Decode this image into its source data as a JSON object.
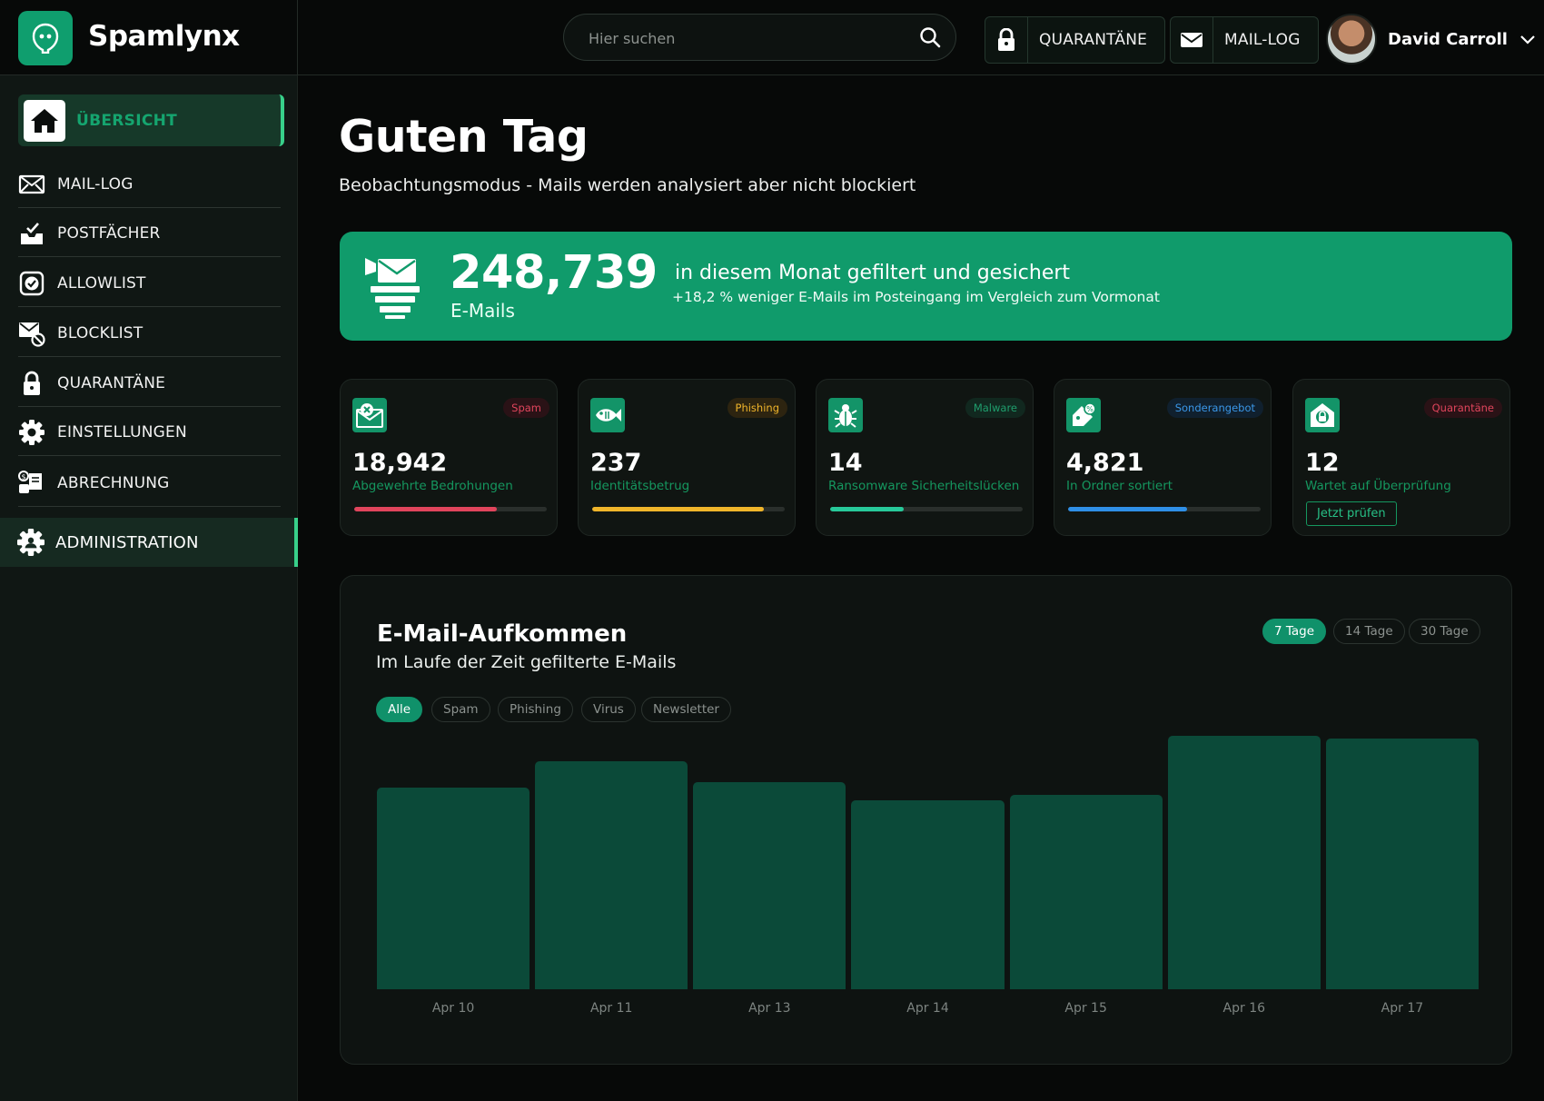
{
  "app": {
    "name": "Spamlynx",
    "search_placeholder": "Hier suchen",
    "top_buttons": {
      "quarantine": "QUARANTÄNE",
      "mail_log": "MAIL-LOG"
    },
    "user": {
      "name": "David Carroll"
    }
  },
  "sidebar": {
    "active": "ÜBERSICHT",
    "items": [
      "MAIL-LOG",
      "POSTFÄCHER",
      "ALLOWLIST",
      "BLOCKLIST",
      "QUARANTÄNE",
      "EINSTELLUNGEN",
      "ABRECHNUNG"
    ],
    "admin": "ADMINISTRATION"
  },
  "main": {
    "greeting": "Guten Tag",
    "subtitle": "Beobachtungsmodus - Mails werden analysiert aber nicht blockiert",
    "hero": {
      "count": "248,739",
      "unit": "E-Mails",
      "headline": "in diesem Monat gefiltert und gesichert",
      "detail": "+18,2 % weniger E-Mails im Posteingang im Vergleich zum Vormonat"
    },
    "cards": [
      {
        "badge": "Spam",
        "value": "18,942",
        "label": "Abgewehrte Bedrohungen",
        "progress": 0.74,
        "color": "#e0455c",
        "badge_bg": "#2a1216",
        "badge_color": "#e0455c"
      },
      {
        "badge": "Phishing",
        "value": "237",
        "label": "Identitätsbetrug",
        "progress": 0.89,
        "color": "#f0b52a",
        "badge_bg": "#2d2410",
        "badge_color": "#f0b52a"
      },
      {
        "badge": "Malware",
        "value": "14",
        "label": "Ransomware Sicherheitslücken",
        "progress": 0.38,
        "color": "#27c99a",
        "badge_bg": "#11281f",
        "badge_color": "#1f9e6d"
      },
      {
        "badge": "Sonderangebot",
        "value": "4,821",
        "label": "In Ordner sortiert",
        "progress": 0.62,
        "color": "#2f8fe6",
        "badge_bg": "#10202e",
        "badge_color": "#3a97e8"
      },
      {
        "badge": "Quarantäne",
        "value": "12",
        "label": "Wartet auf Überprüfung",
        "action": "Jetzt prüfen",
        "badge_bg": "#2a1216",
        "badge_color": "#e0455c"
      }
    ],
    "chart_panel": {
      "title": "E-Mail-Aufkommen",
      "subtitle": "Im Laufe der Zeit gefilterte E-Mails",
      "ranges": [
        "7 Tage",
        "14 Tage",
        "30 Tage"
      ],
      "active_range": "7 Tage",
      "filters": [
        "Alle",
        "Spam",
        "Phishing",
        "Virus",
        "Newsletter"
      ],
      "active_filter": "Alle"
    }
  },
  "chart_data": {
    "type": "bar",
    "categories": [
      "Apr 10",
      "Apr 11",
      "Apr 13",
      "Apr 14",
      "Apr 15",
      "Apr 16",
      "Apr 17"
    ],
    "values": [
      78,
      88,
      80,
      73,
      75,
      98,
      97
    ],
    "ylim": [
      0,
      100
    ],
    "grid": false,
    "color": "#0b4a39"
  }
}
